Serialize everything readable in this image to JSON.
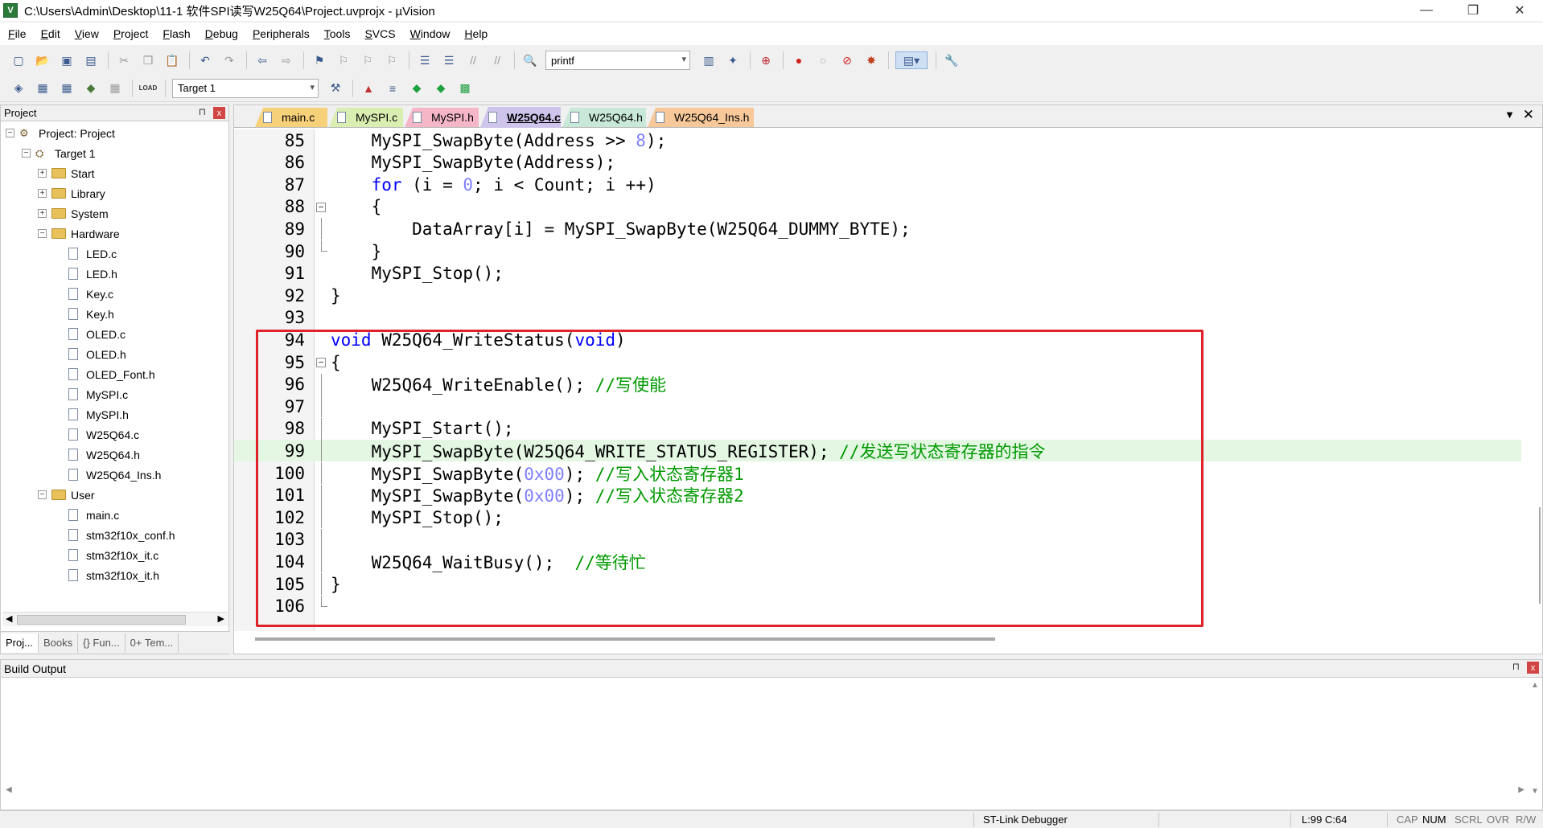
{
  "window": {
    "title": "C:\\Users\\Admin\\Desktop\\11-1 软件SPI读写W25Q64\\Project.uvprojx - µVision",
    "minimize": "—",
    "maximize": "❐",
    "close": "✕"
  },
  "menu": [
    {
      "u": "F",
      "rest": "ile"
    },
    {
      "u": "E",
      "rest": "dit"
    },
    {
      "u": "V",
      "rest": "iew"
    },
    {
      "u": "P",
      "rest": "roject"
    },
    {
      "u": "F",
      "rest": "lash"
    },
    {
      "u": "D",
      "rest": "ebug"
    },
    {
      "u": "P",
      "rest": "eripherals"
    },
    {
      "u": "T",
      "rest": "ools"
    },
    {
      "u": "S",
      "rest": "VCS"
    },
    {
      "u": "W",
      "rest": "indow"
    },
    {
      "u": "H",
      "rest": "elp"
    }
  ],
  "toolbar": {
    "find_value": "printf",
    "target_value": "Target 1",
    "load_label": "LOAD"
  },
  "project_panel": {
    "title": "Project",
    "pin": "⊓",
    "close": "x",
    "root": "Project: Project",
    "target": "Target 1",
    "groups": [
      "Start",
      "Library",
      "System",
      "Hardware"
    ],
    "hardware_files": [
      "LED.c",
      "LED.h",
      "Key.c",
      "Key.h",
      "OLED.c",
      "OLED.h",
      "OLED_Font.h",
      "MySPI.c",
      "MySPI.h",
      "W25Q64.c",
      "W25Q64.h",
      "W25Q64_Ins.h"
    ],
    "user_group": "User",
    "user_files": [
      "main.c",
      "stm32f10x_conf.h",
      "stm32f10x_it.c",
      "stm32f10x_it.h"
    ],
    "tabs": [
      "Proj...",
      "Books",
      "{} Fun...",
      "0+ Tem..."
    ]
  },
  "editor": {
    "tabs": [
      {
        "label": "main.c",
        "color": "#f7d07a"
      },
      {
        "label": "MySPI.c",
        "color": "#d9eeb0"
      },
      {
        "label": "MySPI.h",
        "color": "#f5b6c8"
      },
      {
        "label": "W25Q64.c",
        "color": "#cfc4ec"
      },
      {
        "label": "W25Q64.h",
        "color": "#c8e8d8"
      },
      {
        "label": "W25Q64_Ins.h",
        "color": "#f7c89a"
      }
    ],
    "active_tab": "W25Q64.c",
    "lines": [
      {
        "n": "85",
        "code": "    MySPI_SwapByte(Address >> ",
        "num": "8",
        "tail": ");"
      },
      {
        "n": "86",
        "code": "    MySPI_SwapByte(Address);"
      },
      {
        "n": "87",
        "kw": "for",
        "code": " (i = ",
        "num": "0",
        "tail": "; i < Count; i ++)"
      },
      {
        "n": "88",
        "code": "    {"
      },
      {
        "n": "89",
        "code": "        DataArray[i] = MySPI_SwapByte(W25Q64_DUMMY_BYTE);"
      },
      {
        "n": "90",
        "code": "    }"
      },
      {
        "n": "91",
        "code": "    MySPI_Stop();"
      },
      {
        "n": "92",
        "code": "}"
      },
      {
        "n": "93",
        "code": ""
      },
      {
        "n": "94",
        "kw": "void",
        "code": " W25Q64_WriteStatus(",
        "kw2": "void",
        "tail": ")"
      },
      {
        "n": "95",
        "code": "{"
      },
      {
        "n": "96",
        "code": "    W25Q64_WriteEnable(); ",
        "comment": "//写使能"
      },
      {
        "n": "97",
        "code": ""
      },
      {
        "n": "98",
        "code": "    MySPI_Start();"
      },
      {
        "n": "99",
        "code": "    MySPI_SwapByte(W25Q64_WRITE_STATUS_REGISTER); ",
        "comment": "//发送写状态寄存器的指令"
      },
      {
        "n": "100",
        "code": "    MySPI_SwapByte(",
        "num": "0x00",
        "tail": "); ",
        "comment": "//写入状态寄存器1"
      },
      {
        "n": "101",
        "code": "    MySPI_SwapByte(",
        "num": "0x00",
        "tail": "); ",
        "comment": "//写入状态寄存器2"
      },
      {
        "n": "102",
        "code": "    MySPI_Stop();"
      },
      {
        "n": "103",
        "code": ""
      },
      {
        "n": "104",
        "code": "    W25Q64_WaitBusy();  ",
        "comment": "//等待忙"
      },
      {
        "n": "105",
        "code": "}"
      },
      {
        "n": "106",
        "code": ""
      }
    ]
  },
  "build_output": {
    "title": "Build Output"
  },
  "status": {
    "debugger": "ST-Link Debugger",
    "position": "L:99 C:64",
    "cap": "CAP",
    "num": "NUM",
    "scrl": "SCRL",
    "ovr": "OVR",
    "rw": "R/W"
  }
}
